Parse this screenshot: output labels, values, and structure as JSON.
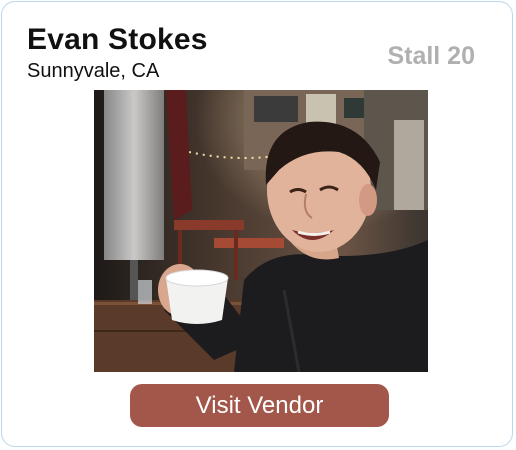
{
  "vendor": {
    "name": "Evan Stokes",
    "location": "Sunnyvale, CA",
    "stall": "Stall 20"
  },
  "photo": {
    "alt": "Photo of Evan Stokes"
  },
  "actions": {
    "visit_label": "Visit Vendor"
  },
  "colors": {
    "button": "#a3574a",
    "stall_text": "#b0b0b0",
    "border": "#b9d8ea"
  }
}
